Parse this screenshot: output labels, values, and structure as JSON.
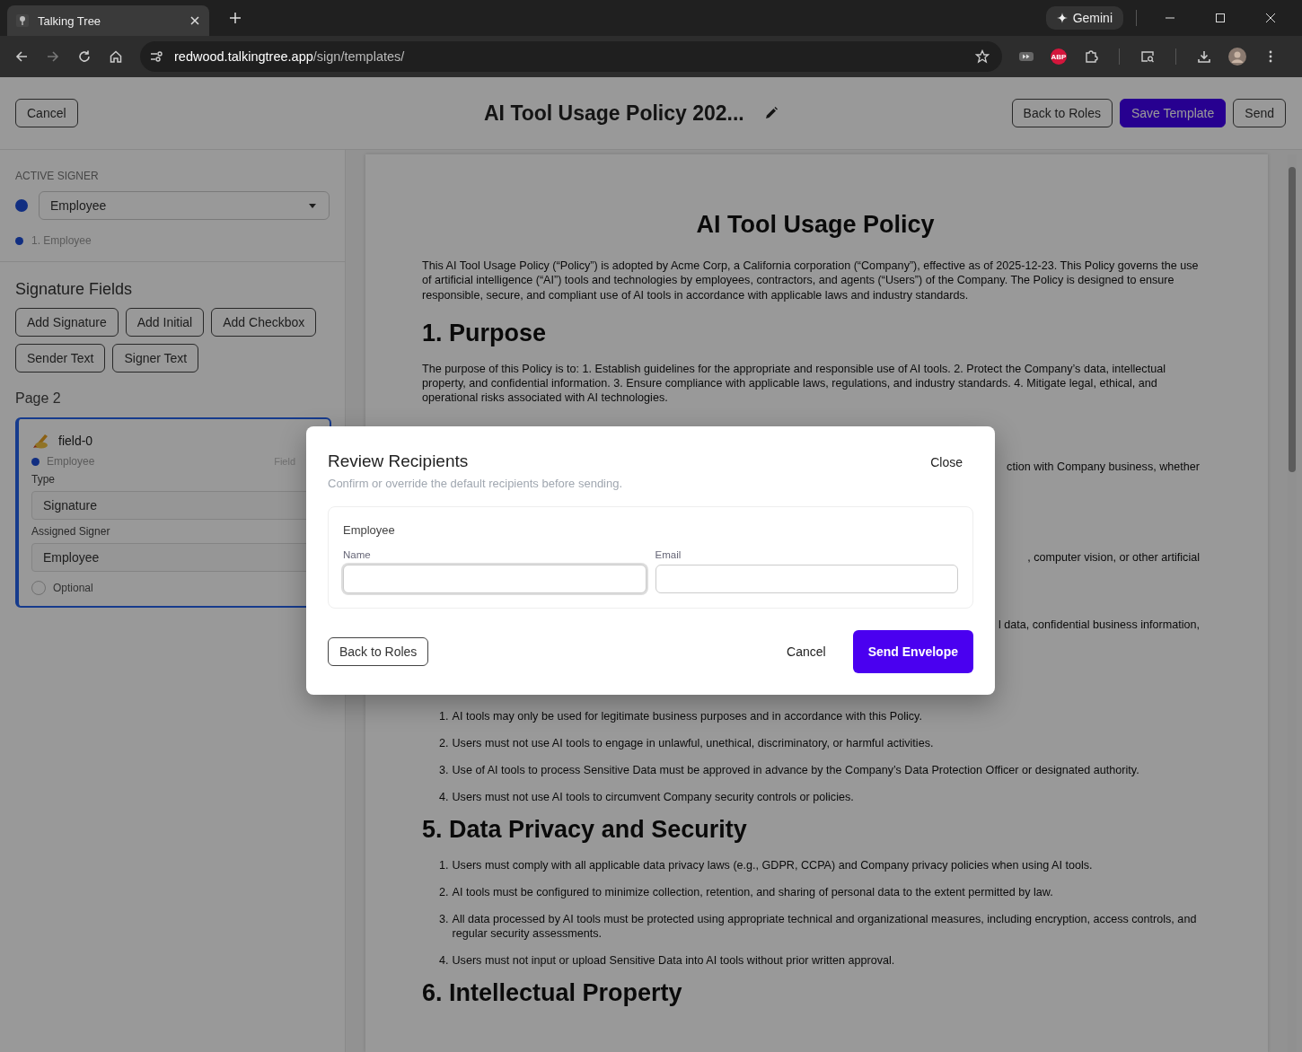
{
  "browser": {
    "tab_title": "Talking Tree",
    "url_host": "redwood.talkingtree.app",
    "url_path": "/sign/templates/",
    "gemini": "Gemini",
    "extension_badge": "ABP"
  },
  "header": {
    "cancel": "Cancel",
    "title": "AI Tool Usage Policy 202...",
    "buttons": [
      {
        "label": "Back to Roles",
        "kind": "outline"
      },
      {
        "label": "Save Template",
        "kind": "primary"
      },
      {
        "label": "Send",
        "kind": "outline"
      }
    ]
  },
  "sidebar": {
    "active_signer_label": "ACTIVE SIGNER",
    "active_signer": "Employee",
    "signers": [
      {
        "label": "1. Employee"
      }
    ],
    "section_title": "Signature Fields",
    "add_buttons": [
      "Add Signature",
      "Add Initial",
      "Add Checkbox",
      "Sender Text",
      "Signer Text"
    ],
    "page_label": "Page 2",
    "field": {
      "name": "field-0",
      "signer": "Employee",
      "tag": "Field",
      "type_label": "Type",
      "type_value": "Signature",
      "assigned_label": "Assigned Signer",
      "assigned_value": "Employee",
      "optional_label": "Optional",
      "optional_checked": false
    }
  },
  "document": {
    "title": "AI Tool Usage Policy",
    "blocks": [
      {
        "kind": "paragraph",
        "text": "This AI Tool Usage Policy (“Policy”) is adopted by Acme Corp, a California corporation (“Company”), effective as of 2025-12-23. This Policy governs the use of artificial intelligence (“AI”) tools and technologies by employees, contractors, and agents (“Users”) of the Company. The Policy is designed to ensure responsible, secure, and compliant use of AI tools in accordance with applicable laws and industry standards."
      },
      {
        "kind": "heading",
        "text": "1. Purpose"
      },
      {
        "kind": "paragraph",
        "text": "The purpose of this Policy is to: 1. Establish guidelines for the appropriate and responsible use of AI tools. 2. Protect the Company’s data, intellectual property, and confidential information. 3. Ensure compliance with applicable laws, regulations, and industry standards. 4. Mitigate legal, ethical, and operational risks associated with AI technologies."
      },
      {
        "kind": "fragment",
        "text": "ction with Company business, whether"
      },
      {
        "kind": "fragment",
        "text": ", computer vision, or other artificial"
      },
      {
        "kind": "fragment",
        "text": "l data, confidential business information,"
      },
      {
        "kind": "list",
        "items": [
          {
            "number": "1.",
            "text": "AI tools may only be used for legitimate business purposes and in accordance with this Policy."
          },
          {
            "number": "2.",
            "text": "Users must not use AI tools to engage in unlawful, unethical, discriminatory, or harmful activities."
          },
          {
            "number": "3.",
            "text": "Use of AI tools to process Sensitive Data must be approved in advance by the Company’s Data Protection Officer or designated authority."
          },
          {
            "number": "4.",
            "text": "Users must not use AI tools to circumvent Company security controls or policies."
          }
        ]
      },
      {
        "kind": "heading",
        "text": "5. Data Privacy and Security"
      },
      {
        "kind": "list",
        "items": [
          {
            "number": "1.",
            "text": "Users must comply with all applicable data privacy laws (e.g., GDPR, CCPA) and Company privacy policies when using AI tools."
          },
          {
            "number": "2.",
            "text": "AI tools must be configured to minimize collection, retention, and sharing of personal data to the extent permitted by law."
          },
          {
            "number": "3.",
            "text": "All data processed by AI tools must be protected using appropriate technical and organizational measures, including encryption, access controls, and regular security assessments."
          },
          {
            "number": "4.",
            "text": "Users must not input or upload Sensitive Data into AI tools without prior written approval."
          }
        ]
      },
      {
        "kind": "heading",
        "text": "6. Intellectual Property"
      }
    ]
  },
  "modal": {
    "title": "Review Recipients",
    "subtitle": "Confirm or override the default recipients before sending.",
    "close": "Close",
    "recipients": [
      {
        "role": "Employee",
        "name_label": "Name",
        "email_label": "Email"
      }
    ],
    "back": "Back to Roles",
    "cancel": "Cancel",
    "send": "Send Envelope"
  }
}
